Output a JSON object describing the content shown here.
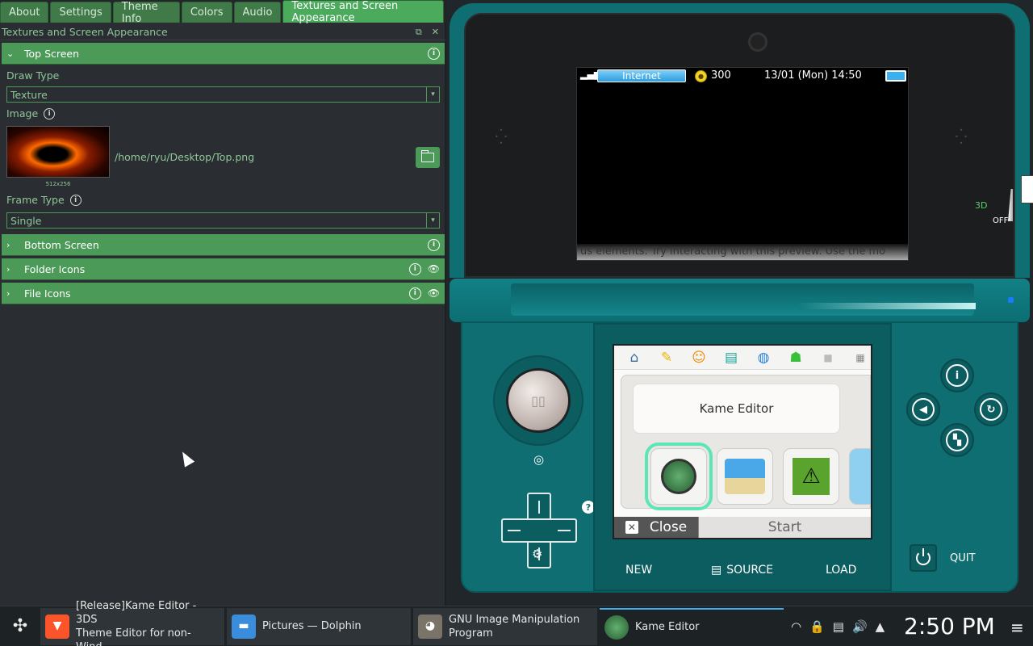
{
  "tabs": [
    {
      "label": "About"
    },
    {
      "label": "Settings"
    },
    {
      "label": "Theme Info"
    },
    {
      "label": "Colors"
    },
    {
      "label": "Audio"
    },
    {
      "label": "Textures and Screen Appearance",
      "active": true
    }
  ],
  "panel": {
    "title": "Textures and Screen Appearance",
    "float_icon": "float-icon",
    "close_icon": "close-icon"
  },
  "top_screen": {
    "label": "Top Screen",
    "draw_type_label": "Draw Type",
    "draw_type_value": "Texture",
    "image_label": "Image",
    "image_size": "512x256",
    "image_path": "/home/ryu/Desktop/Top.png",
    "frame_type_label": "Frame Type",
    "frame_type_value": "Single"
  },
  "sections": [
    {
      "label": "Bottom Screen",
      "eye": false
    },
    {
      "label": "Folder Icons",
      "eye": true
    },
    {
      "label": "File Icons",
      "eye": true
    }
  ],
  "preview": {
    "status": {
      "network": "Internet",
      "coins": "300",
      "datetime": "13/01 (Mon) 14:50"
    },
    "ticker": "us elements.  Try interacting with this preview. Use the mo",
    "slider_3d_label": "3D",
    "slider_3d_state": "OFF",
    "bubble": "Kame Editor",
    "close_label": "Close",
    "start_label": "Start",
    "new_label": "NEW",
    "source_label": "SOURCE",
    "load_label": "LOAD",
    "quit_label": "QUIT"
  },
  "taskbar": {
    "tasks": [
      {
        "line1": "[Release]Kame Editor - 3DS",
        "line2": "Theme Editor for non-Wind...",
        "icon": "brave-icon"
      },
      {
        "line1": "Pictures — Dolphin",
        "line2": "",
        "icon": "dolphin-folder-icon"
      },
      {
        "line1": "GNU Image Manipulation",
        "line2": "Program",
        "icon": "gimp-icon"
      },
      {
        "line1": "Kame Editor",
        "line2": "",
        "icon": "kame-icon",
        "active": true
      }
    ],
    "clock": "2:50 PM"
  },
  "colors": {
    "accent_green": "#4c9a57",
    "teal_body": "#0f6e72",
    "highlight_blue": "#3daee9"
  }
}
